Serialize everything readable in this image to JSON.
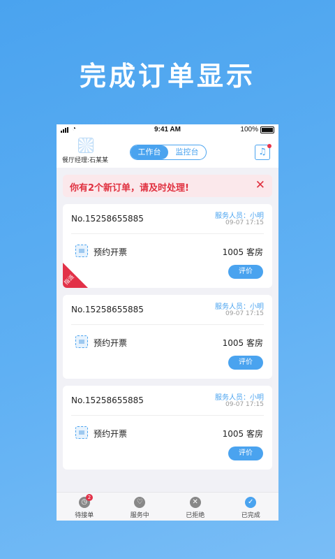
{
  "hero": {
    "title": "完成订单显示"
  },
  "status_bar": {
    "time": "9:41 AM",
    "battery": "100%"
  },
  "header": {
    "manager_label": "餐厅经理:石某某",
    "tabs": [
      {
        "label": "工作台",
        "active": true
      },
      {
        "label": "监控台",
        "active": false
      }
    ]
  },
  "alert": {
    "text": "你有2个新订单，请及时处理!",
    "close_icon": "close-icon"
  },
  "orders": [
    {
      "no": "No.15258655885",
      "staff": "服务人员：小明",
      "time": "09-07 17:15",
      "type": "预约开票",
      "room": "1005 客房",
      "action": "评价",
      "tag": "指派"
    },
    {
      "no": "No.15258655885",
      "staff": "服务人员：小明",
      "time": "09-07 17:15",
      "type": "预约开票",
      "room": "1005 客房",
      "action": "评价"
    },
    {
      "no": "No.15258655885",
      "staff": "服务人员：小明",
      "time": "09-07 17:15",
      "type": "预约开票",
      "room": "1005 客房",
      "action": "评价"
    }
  ],
  "tabbar": [
    {
      "label": "待接单",
      "icon": "clock-icon",
      "badge": "2"
    },
    {
      "label": "服务中",
      "icon": "heart-icon"
    },
    {
      "label": "已拒绝",
      "icon": "close-icon"
    },
    {
      "label": "已完成",
      "icon": "check-icon",
      "active": true
    }
  ],
  "colors": {
    "accent": "#4aa3ef",
    "alert": "#e0303f",
    "tag": "#e23148"
  }
}
